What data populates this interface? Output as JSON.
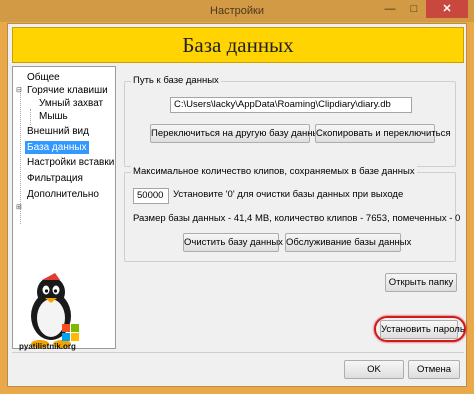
{
  "window": {
    "title": "Настройки",
    "minimize_icon": "minimize-icon",
    "maximize_icon": "maximize-icon",
    "close_icon": "close-icon",
    "minimize_glyph": "—",
    "maximize_glyph": "□",
    "close_glyph": "✕"
  },
  "banner": {
    "title": "База данных"
  },
  "tree": {
    "items": [
      {
        "label": "Общее",
        "level": 0,
        "selected": false,
        "expander": ""
      },
      {
        "label": "Горячие клавиши",
        "level": 0,
        "selected": false,
        "expander": "⊟"
      },
      {
        "label": "Умный захват",
        "level": 1,
        "selected": false,
        "expander": ""
      },
      {
        "label": "Мышь",
        "level": 1,
        "selected": false,
        "expander": ""
      },
      {
        "label": "Внешний вид",
        "level": 0,
        "selected": false,
        "expander": ""
      },
      {
        "label": "База данных",
        "level": 0,
        "selected": true,
        "expander": ""
      },
      {
        "label": "Настройки вставки",
        "level": 0,
        "selected": false,
        "expander": ""
      },
      {
        "label": "Фильтрация",
        "level": 0,
        "selected": false,
        "expander": "⊞"
      },
      {
        "label": "Дополнительно",
        "level": 0,
        "selected": false,
        "expander": ""
      }
    ]
  },
  "logo": {
    "text": "pyatilistnik.org"
  },
  "db_path_group": {
    "legend": "Путь к базе данных",
    "path_value": "C:\\Users\\lacky\\AppData\\Roaming\\Clipdiary\\diary.db",
    "switch_button": "Переключиться на другую базу данных",
    "copy_switch_button": "Скопировать и переключиться"
  },
  "max_clips_group": {
    "legend": "Максимальное количество клипов, сохраняемых в базе данных",
    "max_value": "50000",
    "hint": "Установите '0' для очистки базы данных при выходе",
    "stats": "Размер базы данных - 41,4 MB, количество клипов - 7653, помеченных - 0",
    "clear_button": "Очистить базу данных",
    "maintenance_button": "Обслуживание базы данных"
  },
  "open_folder_button": "Открыть папку",
  "set_password_button": "Установить пароль",
  "ok_button": "OK",
  "cancel_button": "Отмена",
  "colors": {
    "window_frame": "#e9a84a",
    "banner": "#ffd400",
    "selection": "#3399ff",
    "highlight_ring": "#d21a1a",
    "close_button": "#c9483d"
  }
}
